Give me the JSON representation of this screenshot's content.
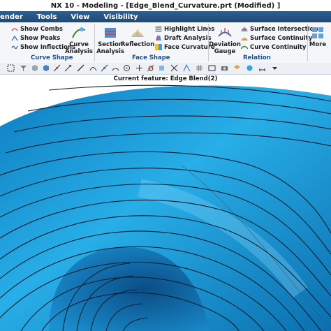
{
  "window": {
    "title": "NX 10 - Modeling - [Edge_Blend_Curvature.prt (Modified) ]"
  },
  "menu": [
    "ender",
    "Tools",
    "View",
    "Visibility"
  ],
  "ribbon": {
    "curve_shape": {
      "label": "Curve Shape",
      "items": [
        "Show Combs",
        "Show Peaks",
        "Show Inflections"
      ],
      "curve_analysis": [
        "Curve",
        "Analysis"
      ]
    },
    "face_shape": {
      "label": "Face Shape",
      "section_analysis": [
        "Section",
        "Analysis"
      ],
      "reflection": "Reflection",
      "items": [
        "Highlight Lines",
        "Draft Analysis",
        "Face Curvature"
      ]
    },
    "relation": {
      "label": "Relation",
      "deviation_gauge": [
        "Deviation",
        "Gauge"
      ],
      "items": [
        "Surface Intersection",
        "Surface Continuity",
        "Curve Continuity"
      ]
    },
    "more": "More"
  },
  "status": {
    "current_feature": "Current feature: Edge Blend(2)"
  },
  "colors": {
    "surface": "#1fa0dc",
    "menubar": "#2e5f8f",
    "group_label": "#1f4f86"
  }
}
